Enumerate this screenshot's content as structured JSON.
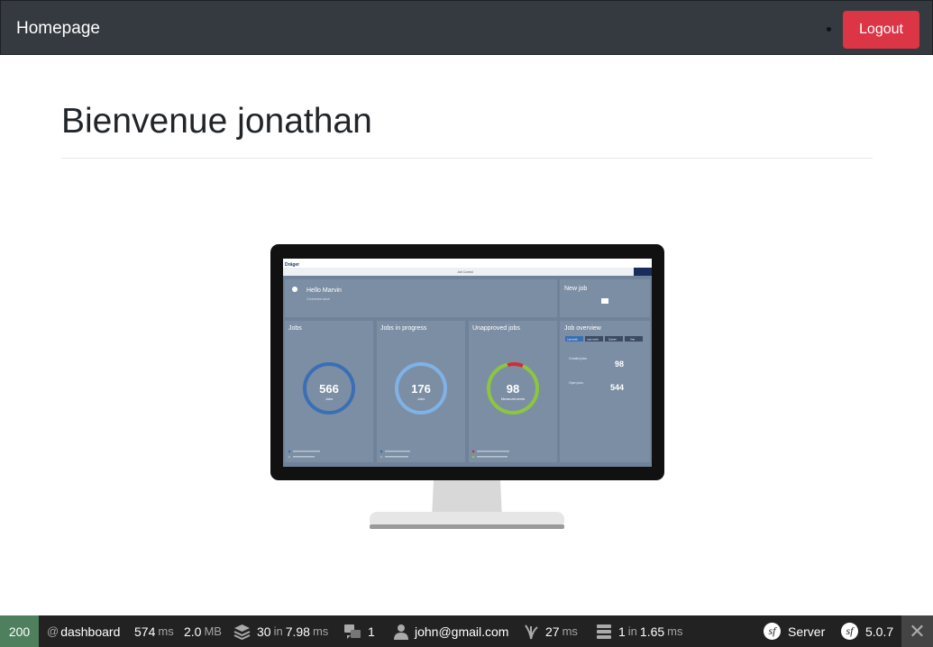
{
  "navbar": {
    "brand": "Homepage",
    "logout_label": "Logout"
  },
  "main": {
    "heading": "Bienvenue jonathan"
  },
  "illustration": {
    "logo": "Dräger",
    "window_title": "Job Control",
    "greeting": "Hello Marvin",
    "greeting_sub": "Connected since",
    "new_job": "New job",
    "jobs": {
      "title": "Jobs",
      "value": "566",
      "unit": "Jobs"
    },
    "in_progress": {
      "title": "Jobs in progress",
      "value": "176",
      "unit": "Jobs"
    },
    "unapproved": {
      "title": "Unapproved jobs",
      "value": "98",
      "unit": "Measurements"
    },
    "overview": {
      "title": "Job overview",
      "tabs": [
        "Last week",
        "Last month",
        "Quarter",
        "Year"
      ],
      "created_label": "Created jobs",
      "created_value": "98",
      "open_label": "Open jobs",
      "open_value": "544"
    },
    "colors": {
      "screen_bg": "#6f8299",
      "ring_blue": "#3a6fb5",
      "ring_light": "#7fb2e5",
      "ring_green": "#8cc63f",
      "ring_red": "#d22b3a"
    }
  },
  "toolbar": {
    "status_code": "200",
    "route_prefix": "@",
    "route": "dashboard",
    "time_value": "574",
    "time_unit": "ms",
    "memory_value": "2.0",
    "memory_unit": "MB",
    "cache_count": "30",
    "cache_in": "in",
    "cache_time": "7.98",
    "cache_unit": "ms",
    "translation_count": "1",
    "user": "john@gmail.com",
    "twig_time": "27",
    "twig_unit": "ms",
    "db_count": "1",
    "db_in": "in",
    "db_time": "1.65",
    "db_unit": "ms",
    "server_label": "Server",
    "version": "5.0.7",
    "colors": {
      "success": "#4f805d",
      "bar": "#222222"
    }
  }
}
